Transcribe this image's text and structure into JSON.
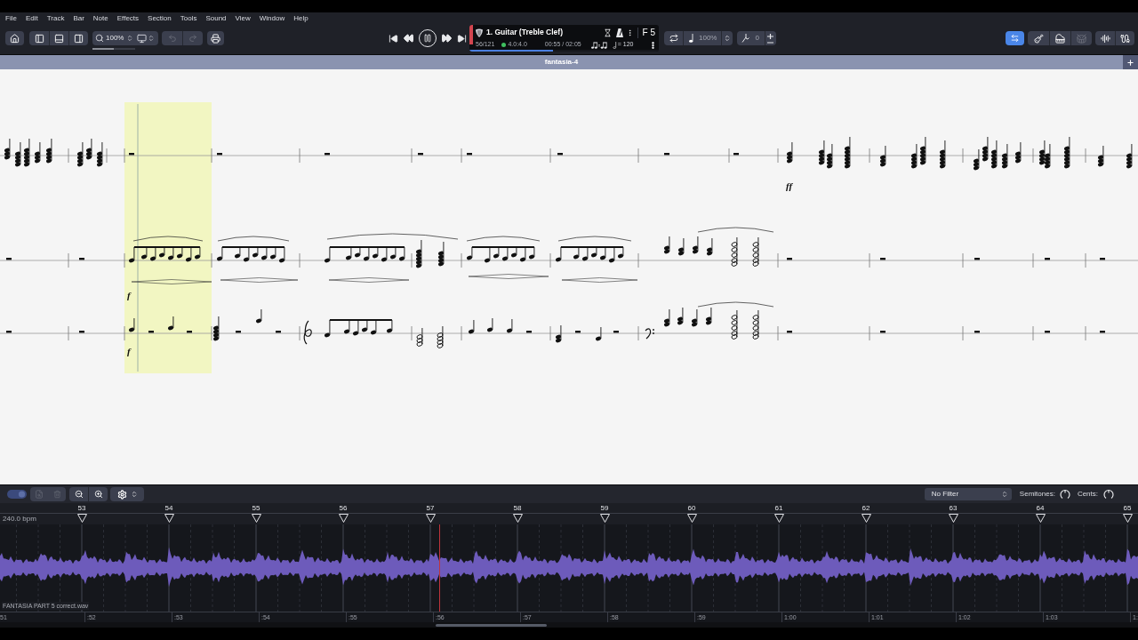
{
  "menu": [
    "File",
    "Edit",
    "Track",
    "Bar",
    "Note",
    "Effects",
    "Section",
    "Tools",
    "Sound",
    "View",
    "Window",
    "Help"
  ],
  "toolbar": {
    "zoom": "100%",
    "zoom_slider": {
      "level": 0.5
    },
    "undo": {
      "disabled": true
    },
    "redo": {
      "disabled": true
    }
  },
  "transport": {
    "playing": true
  },
  "track": {
    "name": "1. Guitar (Treble Clef)",
    "pitch": "F 5",
    "bar": "56/121",
    "time_signature": "4.0:4.0",
    "time": "00:55 / 02:05",
    "tempo": "= 120",
    "level": 0.44
  },
  "playback": {
    "speed": {
      "value": "100%",
      "disabled": true
    },
    "pitch_shift": {
      "value": "0",
      "disabled": true
    }
  },
  "view_toggles": {
    "sync": {
      "selected": true
    },
    "drums": {
      "disabled": true
    }
  },
  "document": {
    "title": "fantasia-4"
  },
  "score": {
    "dynamics": [
      "ff",
      "f",
      "f"
    ]
  },
  "audio": {
    "sync_toggle": {
      "on": true
    },
    "filter": "No Filter",
    "semitones_label": "Semitones:",
    "cents_label": "Cents:",
    "tempo": "240.0 bpm",
    "bars": [
      "53",
      "54",
      "55",
      "56",
      "57",
      "58",
      "59",
      "60",
      "61",
      "62",
      "63",
      "64",
      "65"
    ],
    "file_name": "FANTASIA PART 5 correct.wav",
    "time_labels": [
      "51",
      ":52",
      ":53",
      ":54",
      ":55",
      ":56",
      ":57",
      ":58",
      ":59",
      "1:00",
      "1:01",
      "1:02",
      "1:03",
      "1:"
    ]
  }
}
